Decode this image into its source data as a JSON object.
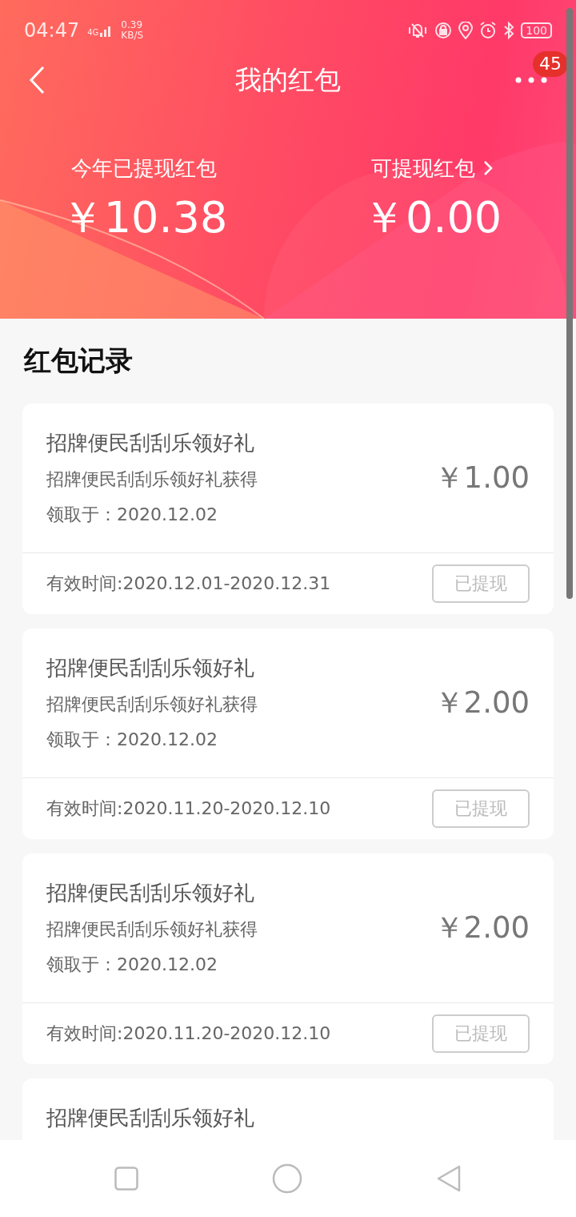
{
  "status_bar": {
    "time": "04:47",
    "network": "4G",
    "speed": "0.39",
    "speed_unit": "KB/S",
    "battery": "100"
  },
  "header": {
    "title": "我的红包",
    "badge": "45"
  },
  "summary": [
    {
      "label": "今年已提现红包",
      "amount": "￥10.38",
      "link": false
    },
    {
      "label": "可提现红包",
      "amount": "￥0.00",
      "link": true
    }
  ],
  "section_title": "红包记录",
  "records": [
    {
      "kind": "full",
      "title": "招牌便民刮刮乐领好礼",
      "subtitle": "招牌便民刮刮乐领好礼获得",
      "date": "领取于：2020.12.02",
      "amount": "￥1.00",
      "validity": "有效时间:2020.12.01-2020.12.31",
      "button": "已提现",
      "disabled": true
    },
    {
      "kind": "full",
      "title": "招牌便民刮刮乐领好礼",
      "subtitle": "招牌便民刮刮乐领好礼获得",
      "date": "领取于：2020.12.02",
      "amount": "￥2.00",
      "validity": "有效时间:2020.11.20-2020.12.10",
      "button": "已提现",
      "disabled": true
    },
    {
      "kind": "full",
      "title": "招牌便民刮刮乐领好礼",
      "subtitle": "招牌便民刮刮乐领好礼获得",
      "date": "领取于：2020.12.02",
      "amount": "￥2.00",
      "validity": "有效时间:2020.11.20-2020.12.10",
      "button": "已提现",
      "disabled": true
    },
    {
      "kind": "partial",
      "title": "招牌便民刮刮乐领好礼"
    }
  ]
}
